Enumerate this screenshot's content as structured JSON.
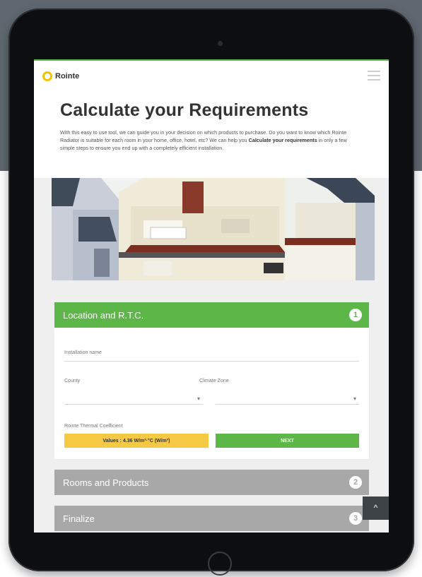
{
  "brand": {
    "logo_text": "Rointe",
    "accent_color": "#5cb748",
    "logo_color": "#f2c400"
  },
  "header": {
    "menu_icon": "hamburger-menu-icon"
  },
  "intro": {
    "title": "Calculate your Requirements",
    "description_1": "With this easy to use tool, we can guide you in your decision on which products to purchase. Do you want to know which Rointe Radiator is suitable for each room in your home, office, hotel, etc? We can help you ",
    "description_bold": "Calculate your requirements",
    "description_2": " in only a few simple steps to ensure you end up with a completely efficient installation."
  },
  "steps": [
    {
      "label": "Location and R.T.C.",
      "number": "1"
    },
    {
      "label": "Rooms and Products",
      "number": "2"
    },
    {
      "label": "Finalize",
      "number": "3"
    }
  ],
  "form": {
    "installation_name_label": "Installation name",
    "county_label": "County",
    "climate_zone_label": "Climate Zone",
    "rtc_label": "Rointe Thermal Coefficient",
    "rtc_button": "Values : 4.36 W/m³·°C (W/m³)",
    "next_button": "NEXT"
  },
  "scroll_top": {
    "label": "^"
  }
}
